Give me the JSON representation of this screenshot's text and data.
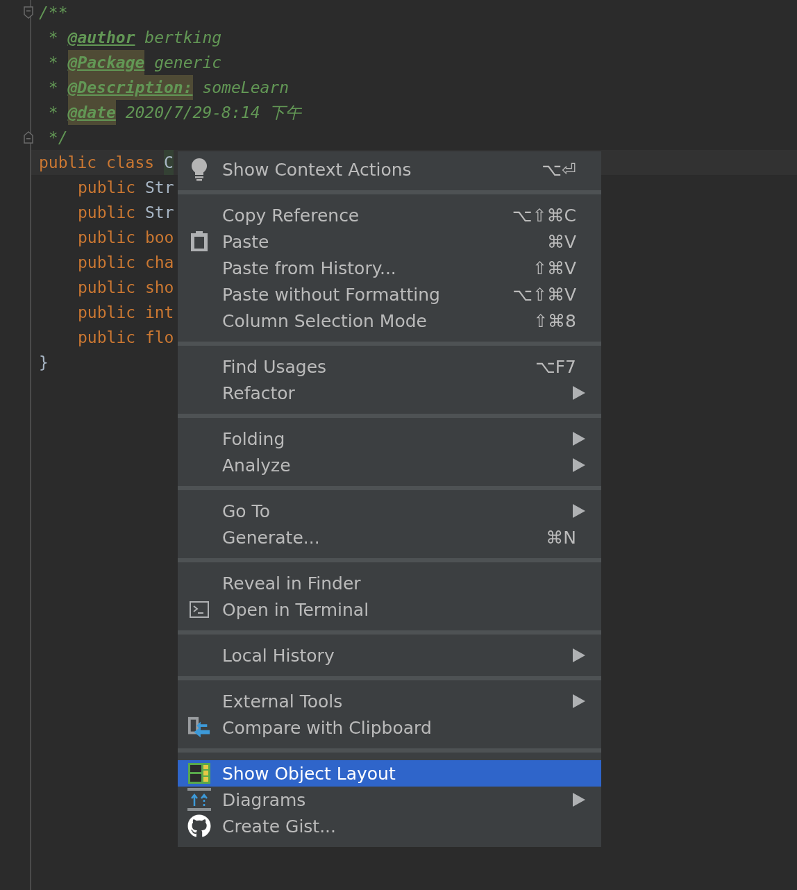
{
  "editor": {
    "lines": [
      {
        "kind": "fold-start",
        "tokens": [
          {
            "kind": "comment",
            "text": "/**"
          }
        ]
      },
      {
        "kind": "code",
        "tokens": [
          {
            "kind": "comment",
            "text": " * "
          },
          {
            "kind": "doctag",
            "text": "@author",
            "highlighted": false
          },
          {
            "kind": "comment",
            "text": " bertking"
          }
        ]
      },
      {
        "kind": "code",
        "tokens": [
          {
            "kind": "comment",
            "text": " * "
          },
          {
            "kind": "doctag",
            "text": "@Package",
            "highlighted": true
          },
          {
            "kind": "comment",
            "text": " generic"
          }
        ]
      },
      {
        "kind": "code",
        "tokens": [
          {
            "kind": "comment",
            "text": " * "
          },
          {
            "kind": "doctag",
            "text": "@Description:",
            "highlighted": true
          },
          {
            "kind": "comment",
            "text": " someLearn"
          }
        ]
      },
      {
        "kind": "code",
        "tokens": [
          {
            "kind": "comment",
            "text": " * "
          },
          {
            "kind": "doctag",
            "text": "@date",
            "highlighted": true
          },
          {
            "kind": "comment",
            "text": " 2020/7/29-8:14 下午"
          }
        ]
      },
      {
        "kind": "fold-end",
        "tokens": [
          {
            "kind": "comment",
            "text": " */"
          }
        ]
      },
      {
        "kind": "code",
        "current": true,
        "tokens": [
          {
            "kind": "keyword",
            "text": "public class "
          },
          {
            "kind": "identifier",
            "text": "C"
          }
        ],
        "children": [
          {
            "kind": "code",
            "tokens": [
              {
                "kind": "keyword",
                "text": "public "
              },
              {
                "kind": "identifier",
                "text": "Str"
              }
            ]
          },
          {
            "kind": "code",
            "tokens": [
              {
                "kind": "keyword",
                "text": "public "
              },
              {
                "kind": "identifier",
                "text": "Str"
              }
            ]
          },
          {
            "kind": "code",
            "tokens": [
              {
                "kind": "keyword",
                "text": "public boo"
              }
            ]
          },
          {
            "kind": "code",
            "tokens": [
              {
                "kind": "keyword",
                "text": "public cha"
              }
            ]
          },
          {
            "kind": "code",
            "tokens": [
              {
                "kind": "keyword",
                "text": "public sho"
              }
            ]
          },
          {
            "kind": "code",
            "tokens": [
              {
                "kind": "keyword",
                "text": "public int"
              }
            ]
          },
          {
            "kind": "code",
            "tokens": [
              {
                "kind": "keyword",
                "text": "public flo"
              }
            ]
          }
        ]
      },
      {
        "kind": "code",
        "tokens": [
          {
            "kind": "identifier",
            "text": "}"
          }
        ]
      }
    ]
  },
  "context_menu": {
    "groups": [
      [
        {
          "kind": "bulb",
          "label": "Show Context Actions",
          "shortcut": "⌥⏎",
          "submenu": false,
          "selected": false
        }
      ],
      [
        {
          "kind": "plain",
          "label": "Copy Reference",
          "shortcut": "⌥⇧⌘C",
          "submenu": false,
          "selected": false
        },
        {
          "kind": "clipboard",
          "label": "Paste",
          "shortcut": "⌘V",
          "submenu": false,
          "selected": false
        },
        {
          "kind": "plain",
          "label": "Paste from History...",
          "shortcut": "⇧⌘V",
          "submenu": false,
          "selected": false
        },
        {
          "kind": "plain",
          "label": "Paste without Formatting",
          "shortcut": "⌥⇧⌘V",
          "submenu": false,
          "selected": false
        },
        {
          "kind": "plain",
          "label": "Column Selection Mode",
          "shortcut": "⇧⌘8",
          "submenu": false,
          "selected": false
        }
      ],
      [
        {
          "kind": "plain",
          "label": "Find Usages",
          "shortcut": "⌥F7",
          "submenu": false,
          "selected": false
        },
        {
          "kind": "plain",
          "label": "Refactor",
          "submenu": true,
          "selected": false
        }
      ],
      [
        {
          "kind": "plain",
          "label": "Folding",
          "submenu": true,
          "selected": false
        },
        {
          "kind": "plain",
          "label": "Analyze",
          "submenu": true,
          "selected": false
        }
      ],
      [
        {
          "kind": "plain",
          "label": "Go To",
          "submenu": true,
          "selected": false
        },
        {
          "kind": "plain",
          "label": "Generate...",
          "shortcut": "⌘N",
          "submenu": false,
          "selected": false
        }
      ],
      [
        {
          "kind": "plain",
          "label": "Reveal in Finder",
          "submenu": false,
          "selected": false
        },
        {
          "kind": "terminal",
          "label": "Open in Terminal",
          "submenu": false,
          "selected": false
        }
      ],
      [
        {
          "kind": "plain",
          "label": "Local History",
          "submenu": true,
          "selected": false
        }
      ],
      [
        {
          "kind": "plain",
          "label": "External Tools",
          "submenu": true,
          "selected": false
        },
        {
          "kind": "compare",
          "label": "Compare with Clipboard",
          "submenu": false,
          "selected": false
        }
      ],
      [
        {
          "kind": "layout",
          "label": "Show Object Layout",
          "submenu": false,
          "selected": true
        },
        {
          "kind": "diagrams",
          "label": "Diagrams",
          "submenu": true,
          "selected": false
        },
        {
          "kind": "github",
          "label": "Create Gist...",
          "submenu": false,
          "selected": false
        }
      ]
    ]
  }
}
